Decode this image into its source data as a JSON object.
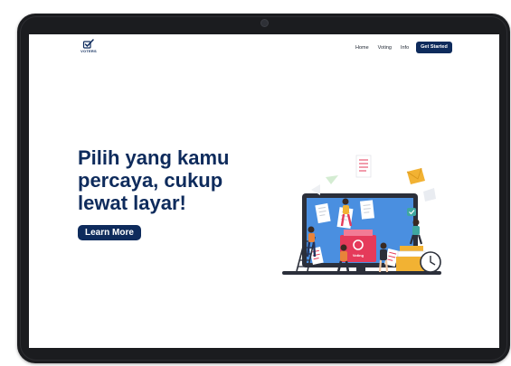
{
  "header": {
    "logo_text": "VOTERS",
    "nav": [
      {
        "label": "Home"
      },
      {
        "label": "Voting"
      },
      {
        "label": "Info"
      }
    ],
    "cta_label": "Get Started"
  },
  "hero": {
    "title_lines": [
      "Pilih yang kamu",
      "percaya, cukup",
      "lewat layar!"
    ],
    "button_label": "Learn More"
  },
  "illustration": {
    "monitor_label": "Voting"
  },
  "colors": {
    "brand_navy": "#0e2b5c",
    "frame": "#1b1c1f",
    "screen_blue": "#4a8fe0",
    "ballot_red": "#e53a5a",
    "accent_yellow": "#f2b233"
  }
}
